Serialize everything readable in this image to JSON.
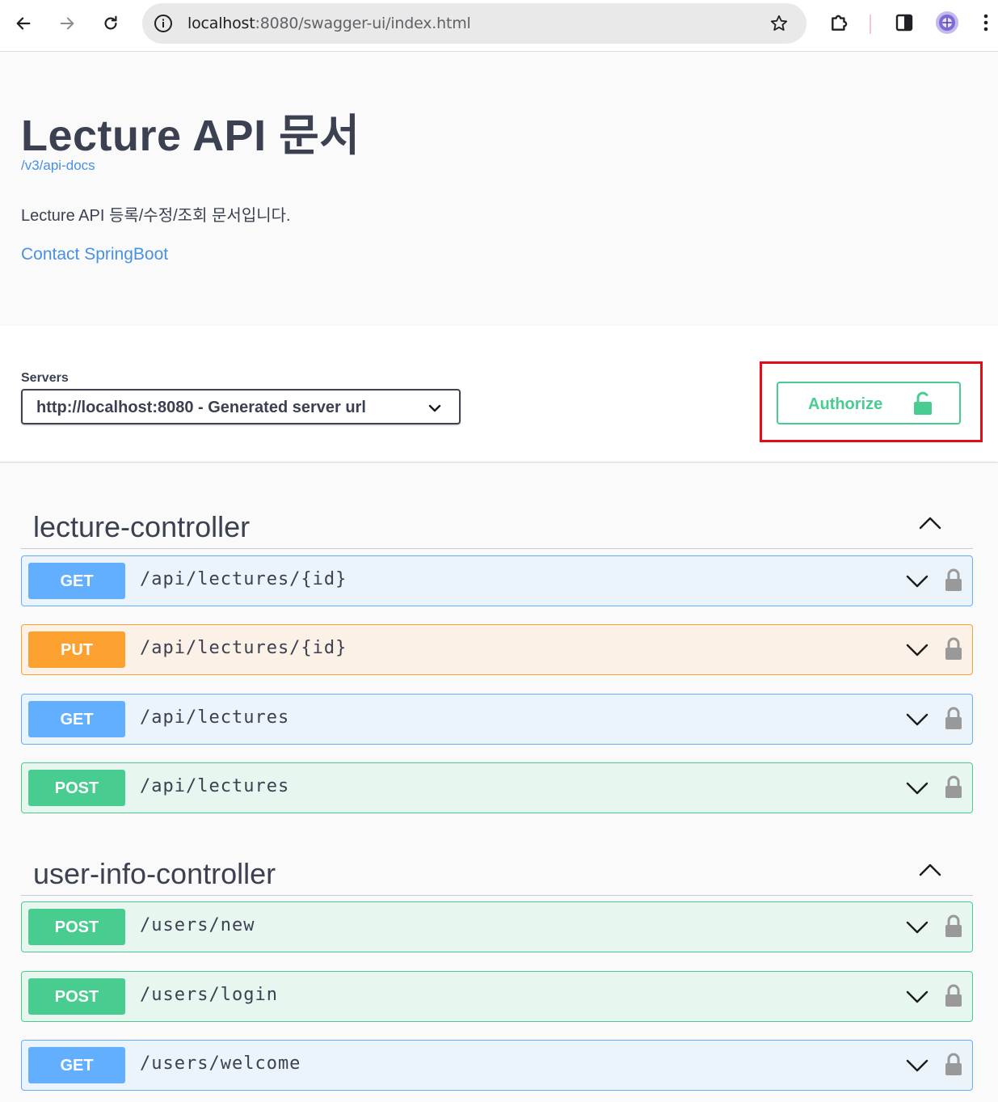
{
  "browser": {
    "url_host": "localhost",
    "url_rest": ":8080/swagger-ui/index.html"
  },
  "info": {
    "title": "Lecture API 문서",
    "api_docs_link": "/v3/api-docs",
    "description": "Lecture API 등록/수정/조회 문서입니다.",
    "contact_link": "Contact SpringBoot"
  },
  "servers": {
    "label": "Servers",
    "selected": "http://localhost:8080 - Generated server url"
  },
  "authorize": {
    "label": "Authorize"
  },
  "tags": [
    {
      "name": "lecture-controller",
      "operations": [
        {
          "method": "GET",
          "path": "/api/lectures/{id}"
        },
        {
          "method": "PUT",
          "path": "/api/lectures/{id}"
        },
        {
          "method": "GET",
          "path": "/api/lectures"
        },
        {
          "method": "POST",
          "path": "/api/lectures"
        }
      ]
    },
    {
      "name": "user-info-controller",
      "operations": [
        {
          "method": "POST",
          "path": "/users/new"
        },
        {
          "method": "POST",
          "path": "/users/login"
        },
        {
          "method": "GET",
          "path": "/users/welcome"
        }
      ]
    }
  ],
  "colors": {
    "get": "#61affe",
    "put": "#fca130",
    "post": "#49cc90",
    "highlight": "#e30d17",
    "link": "#4990e2"
  }
}
